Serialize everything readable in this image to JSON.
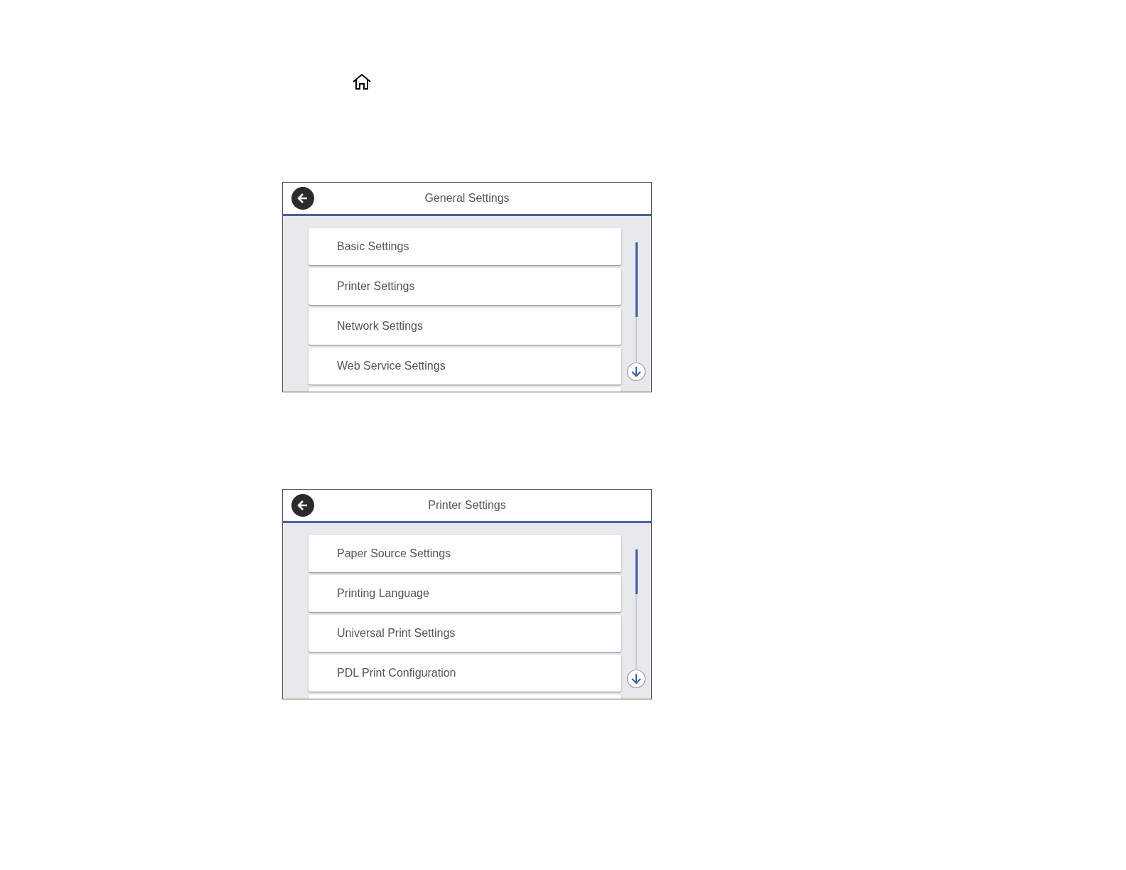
{
  "screens": [
    {
      "title": "General Settings",
      "items": [
        {
          "label": "Basic Settings"
        },
        {
          "label": "Printer Settings"
        },
        {
          "label": "Network Settings"
        },
        {
          "label": "Web Service Settings"
        }
      ]
    },
    {
      "title": "Printer Settings",
      "items": [
        {
          "label": "Paper Source Settings"
        },
        {
          "label": "Printing Language"
        },
        {
          "label": "Universal Print Settings"
        },
        {
          "label": "PDL Print Configuration"
        }
      ]
    }
  ]
}
